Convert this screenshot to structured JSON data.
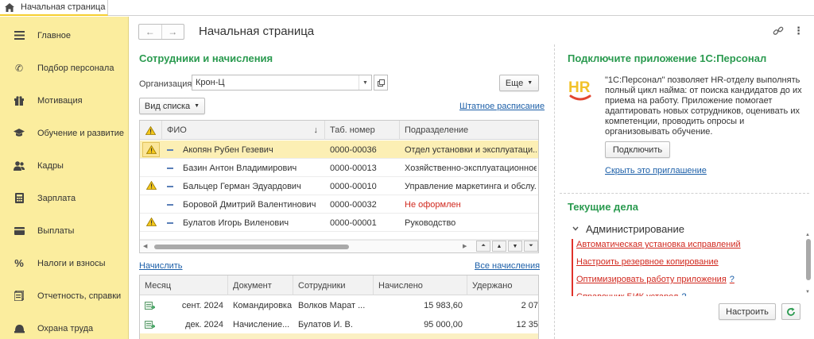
{
  "tabs": {
    "home_label": "Начальная страница"
  },
  "sidebar": {
    "items": [
      {
        "label": "Главное",
        "icon": "menu-icon"
      },
      {
        "label": "Подбор персонала",
        "icon": "phone-icon"
      },
      {
        "label": "Мотивация",
        "icon": "gift-icon"
      },
      {
        "label": "Обучение и развитие",
        "icon": "graduation-cap-icon"
      },
      {
        "label": "Кадры",
        "icon": "users-icon"
      },
      {
        "label": "Зарплата",
        "icon": "calculator-icon"
      },
      {
        "label": "Выплаты",
        "icon": "wallet-icon"
      },
      {
        "label": "Налоги и взносы",
        "icon": "percent-icon"
      },
      {
        "label": "Отчетность, справки",
        "icon": "reports-icon"
      },
      {
        "label": "Охрана труда",
        "icon": "safety-icon"
      }
    ]
  },
  "header": {
    "title": "Начальная страница"
  },
  "employees": {
    "title": "Сотрудники и начисления",
    "org_label": "Организация:",
    "org_value": "Крон-Ц",
    "more_button": "Еще",
    "view_button": "Вид списка",
    "staff_link": "Штатное расписание",
    "columns": {
      "name": "ФИО",
      "tab": "Таб. номер",
      "dept": "Подразделение"
    },
    "rows": [
      {
        "warn": true,
        "name": "Акопян Рубен Гезевич",
        "tab": "0000-00036",
        "dept": "Отдел установки и эксплуатаци...",
        "dept_red": false,
        "selected": true
      },
      {
        "warn": false,
        "name": "Базин Антон Владимирович",
        "tab": "0000-00013",
        "dept": "Хозяйственно-эксплуатационное ...",
        "dept_red": false,
        "selected": false
      },
      {
        "warn": true,
        "name": "Бальцер Герман Эдуардович",
        "tab": "0000-00010",
        "dept": "Управление маркетинга и обслу...",
        "dept_red": false,
        "selected": false
      },
      {
        "warn": false,
        "name": "Боровой Дмитрий Валентинович",
        "tab": "0000-00032",
        "dept": "Не оформлен",
        "dept_red": true,
        "selected": false
      },
      {
        "warn": true,
        "name": "Булатов Игорь Виленович",
        "tab": "0000-00001",
        "dept": "Руководство",
        "dept_red": false,
        "selected": false
      }
    ],
    "accrue_link": "Начислить",
    "all_accruals_link": "Все начисления"
  },
  "accruals": {
    "columns": {
      "month": "Месяц",
      "doc": "Документ",
      "staff": "Сотрудники",
      "accrued": "Начислено",
      "withheld": "Удержано"
    },
    "rows": [
      {
        "month": "сент. 2024",
        "doc": "Командировка",
        "staff": "Волков Марат ...",
        "accrued": "15 983,60",
        "withheld": "2 07"
      },
      {
        "month": "дек. 2024",
        "doc": "Начисление...",
        "staff": "Булатов И. В.",
        "accrued": "95 000,00",
        "withheld": "12 35"
      }
    ]
  },
  "promo": {
    "title": "Подключите приложение 1С:Персонал",
    "logo_text": "HR",
    "text": "\"1С:Персонал\" позволяет HR-отделу выполнять полный цикл найма: от поиска кандидатов до их приема на работу. Приложение помогает адаптировать новых сотрудников, оценивать их компетенции, проводить опросы и организовывать обучение.",
    "connect_button": "Подключить",
    "hide_link": "Скрыть это приглашение"
  },
  "tasks": {
    "title": "Текущие дела",
    "group": "Администрирование",
    "items": [
      {
        "label": "Автоматическая установка исправлений",
        "help": ""
      },
      {
        "label": "Настроить резервное копирование",
        "help": ""
      },
      {
        "label": "Оптимизировать работу приложения",
        "help": "?"
      },
      {
        "label": "Справочник БИК устарел",
        "help": "?"
      }
    ],
    "settings_button": "Настроить"
  },
  "colors": {
    "accent_green": "#2a9a4f",
    "sidebar_bg": "#fbed9e",
    "selection": "#fcefb4",
    "alert_red": "#d1281e",
    "link_blue": "#1c5fa8"
  }
}
